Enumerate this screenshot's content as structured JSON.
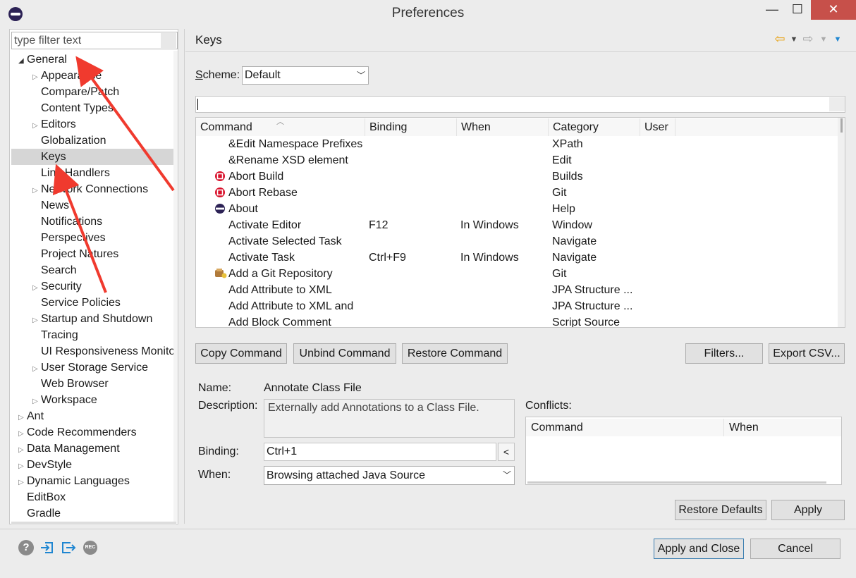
{
  "window": {
    "title": "Preferences",
    "minimize": "—",
    "maximize": "☐",
    "close": "✕"
  },
  "filter": {
    "value": "type filter text"
  },
  "tree": [
    {
      "label": "General",
      "level": 0,
      "expander": "expanded"
    },
    {
      "label": "Appearance",
      "level": 1,
      "expander": "collapsed"
    },
    {
      "label": "Compare/Patch",
      "level": 1,
      "expander": "none"
    },
    {
      "label": "Content Types",
      "level": 1,
      "expander": "none"
    },
    {
      "label": "Editors",
      "level": 1,
      "expander": "collapsed"
    },
    {
      "label": "Globalization",
      "level": 1,
      "expander": "none"
    },
    {
      "label": "Keys",
      "level": 1,
      "expander": "none",
      "selected": true
    },
    {
      "label": "Link Handlers",
      "level": 1,
      "expander": "none"
    },
    {
      "label": "Network Connections",
      "level": 1,
      "expander": "collapsed"
    },
    {
      "label": "News",
      "level": 1,
      "expander": "none"
    },
    {
      "label": "Notifications",
      "level": 1,
      "expander": "none"
    },
    {
      "label": "Perspectives",
      "level": 1,
      "expander": "none"
    },
    {
      "label": "Project Natures",
      "level": 1,
      "expander": "none"
    },
    {
      "label": "Search",
      "level": 1,
      "expander": "none"
    },
    {
      "label": "Security",
      "level": 1,
      "expander": "collapsed"
    },
    {
      "label": "Service Policies",
      "level": 1,
      "expander": "none"
    },
    {
      "label": "Startup and Shutdown",
      "level": 1,
      "expander": "collapsed"
    },
    {
      "label": "Tracing",
      "level": 1,
      "expander": "none"
    },
    {
      "label": "UI Responsiveness Monitoring",
      "level": 1,
      "expander": "none"
    },
    {
      "label": "User Storage Service",
      "level": 1,
      "expander": "collapsed"
    },
    {
      "label": "Web Browser",
      "level": 1,
      "expander": "none"
    },
    {
      "label": "Workspace",
      "level": 1,
      "expander": "collapsed"
    },
    {
      "label": "Ant",
      "level": 0,
      "expander": "collapsed"
    },
    {
      "label": "Code Recommenders",
      "level": 0,
      "expander": "collapsed"
    },
    {
      "label": "Data Management",
      "level": 0,
      "expander": "collapsed"
    },
    {
      "label": "DevStyle",
      "level": 0,
      "expander": "collapsed"
    },
    {
      "label": "Dynamic Languages",
      "level": 0,
      "expander": "collapsed"
    },
    {
      "label": "EditBox",
      "level": 0,
      "expander": "none"
    },
    {
      "label": "Gradle",
      "level": 0,
      "expander": "none"
    }
  ],
  "page": {
    "title": "Keys",
    "scheme_label_first": "S",
    "scheme_label_rest": "cheme:",
    "scheme_value": "Default"
  },
  "table": {
    "columns": [
      "Command",
      "Binding",
      "When",
      "Category",
      "User"
    ],
    "rows": [
      {
        "command": "&Edit Namespace Prefixes",
        "binding": "",
        "when": "",
        "category": "XPath",
        "icon": ""
      },
      {
        "command": "&Rename XSD element",
        "binding": "",
        "when": "",
        "category": "Edit",
        "icon": ""
      },
      {
        "command": "Abort Build",
        "binding": "",
        "when": "",
        "category": "Builds",
        "icon": "stop-icon"
      },
      {
        "command": "Abort Rebase",
        "binding": "",
        "when": "",
        "category": "Git",
        "icon": "stop-icon"
      },
      {
        "command": "About",
        "binding": "",
        "when": "",
        "category": "Help",
        "icon": "eclipse-icon"
      },
      {
        "command": "Activate Editor",
        "binding": "F12",
        "when": "In Windows",
        "category": "Window",
        "icon": ""
      },
      {
        "command": "Activate Selected Task",
        "binding": "",
        "when": "",
        "category": "Navigate",
        "icon": ""
      },
      {
        "command": "Activate Task",
        "binding": "Ctrl+F9",
        "when": "In Windows",
        "category": "Navigate",
        "icon": ""
      },
      {
        "command": "Add a Git Repository",
        "binding": "",
        "when": "",
        "category": "Git",
        "icon": "git-repo-icon"
      },
      {
        "command": "Add Attribute to XML",
        "binding": "",
        "when": "",
        "category": "JPA Structure ...",
        "icon": ""
      },
      {
        "command": "Add Attribute to XML and",
        "binding": "",
        "when": "",
        "category": "JPA Structure ...",
        "icon": ""
      },
      {
        "command": "Add Block Comment",
        "binding": "",
        "when": "",
        "category": "Script Source",
        "icon": ""
      }
    ]
  },
  "buttons": {
    "copy_command": "Copy Command",
    "unbind_command": "Unbind Command",
    "restore_command": "Restore Command",
    "filters": "Filters...",
    "export_csv": "Export CSV...",
    "restore_defaults": "Restore Defaults",
    "apply": "Apply",
    "apply_and_close": "Apply and Close",
    "cancel": "Cancel"
  },
  "details": {
    "name_label": "Name:",
    "name_value": "Annotate Class File",
    "description_label": "Description:",
    "description_value": "Externally add Annotations to a Class File.",
    "binding_label": "Binding:",
    "binding_value": "Ctrl+1",
    "binding_button": "<",
    "when_label": "When:",
    "when_value": "Browsing attached Java Source"
  },
  "conflicts": {
    "label": "Conflicts:",
    "columns": [
      "Command",
      "When"
    ]
  },
  "colors": {
    "selection": "#d6d6d6",
    "stop_red": "#d8102a",
    "nav_arrow_yellow": "#e8a317",
    "icon_blue": "#1f86d1",
    "annotation_red": "#f03a2e"
  }
}
